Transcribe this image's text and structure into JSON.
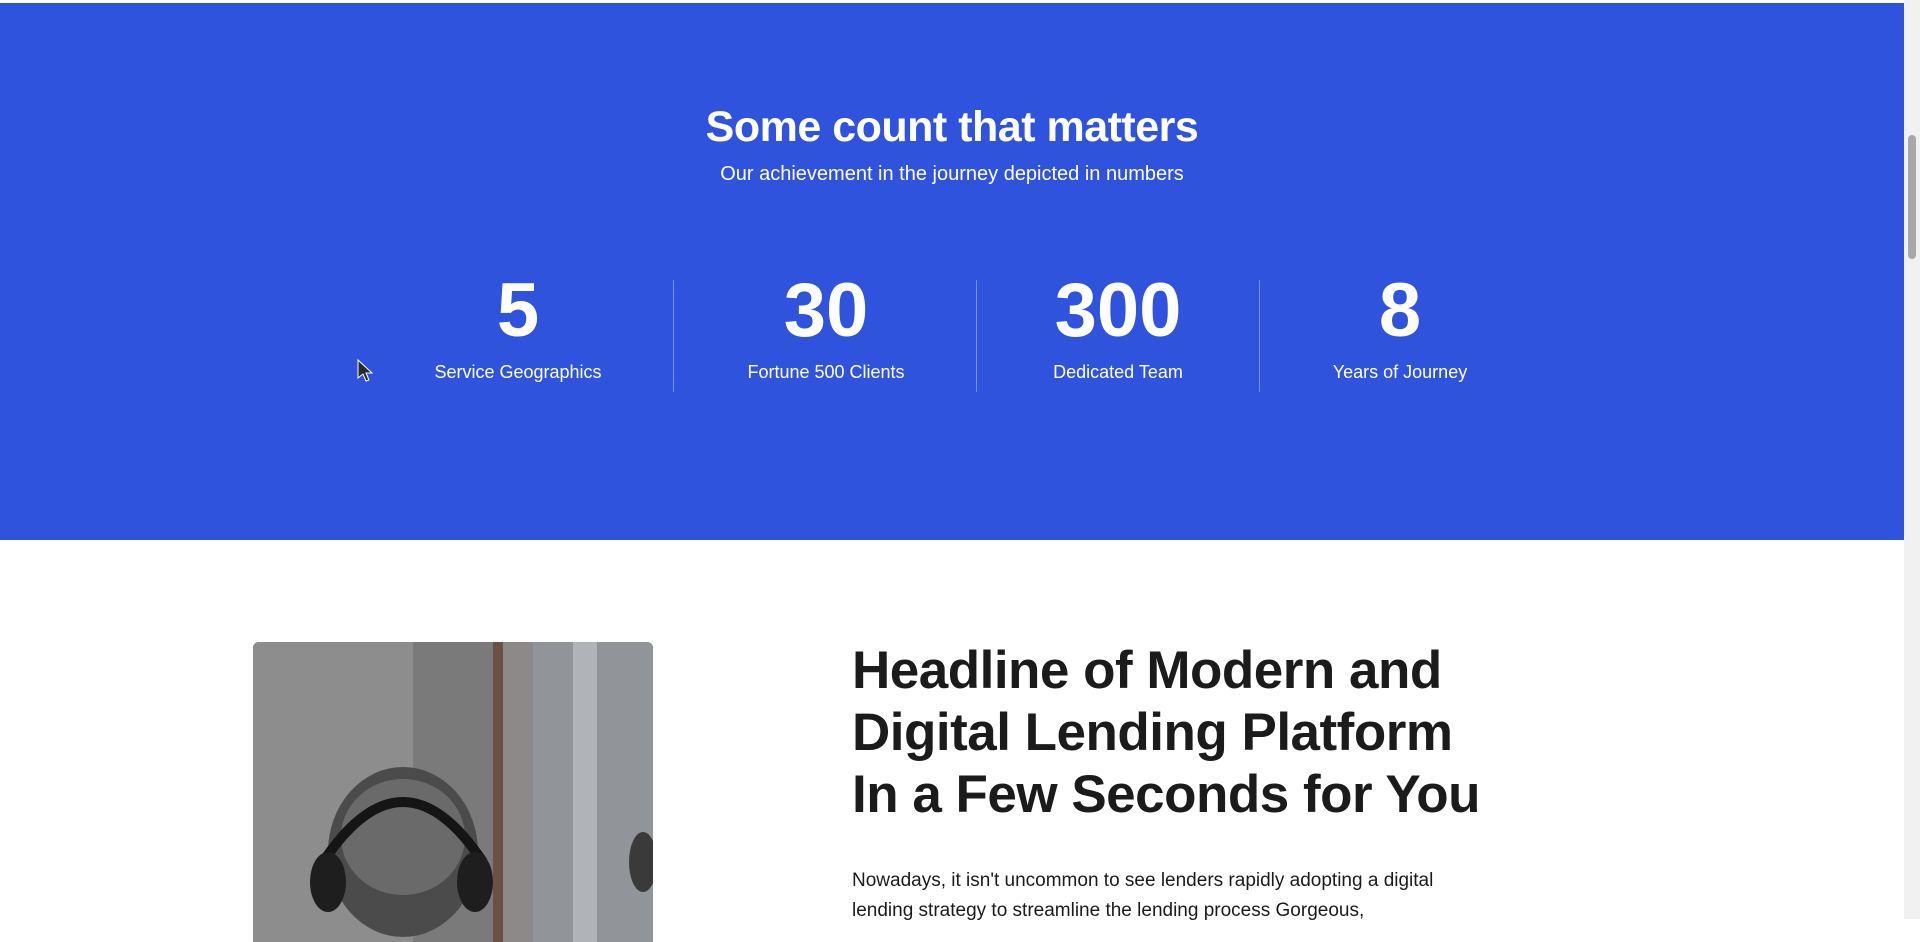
{
  "stats": {
    "title": "Some count that matters",
    "subtitle": "Our achievement in the journey depicted in numbers",
    "items": [
      {
        "value": "5",
        "label": "Service Geographics"
      },
      {
        "value": "30",
        "label": "Fortune 500 Clients"
      },
      {
        "value": "300",
        "label": "Dedicated Team"
      },
      {
        "value": "8",
        "label": "Years of Journey"
      }
    ],
    "background_color": "#2f53dc"
  },
  "feature": {
    "headline": "Headline of Modern and Digital Lending Platform In a Few Seconds for You",
    "body": "Nowadays, it isn't uncommon to see lenders rapidly adopting a digital lending strategy to streamline the lending process Gorgeous,",
    "image_icon": "photo-headphones-person"
  }
}
